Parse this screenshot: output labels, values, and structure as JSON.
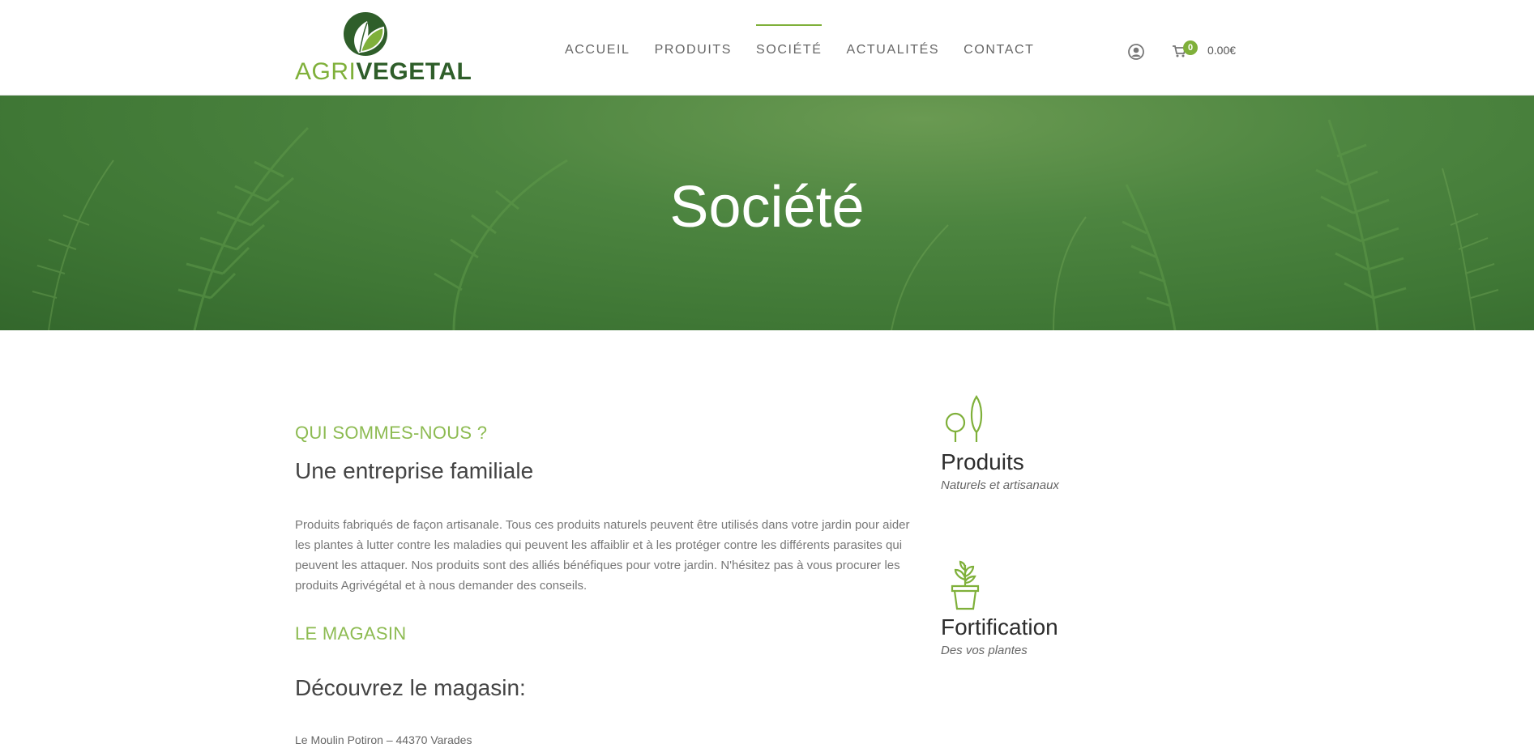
{
  "brand": {
    "part1": "AGRI",
    "part2": "VEGETAL",
    "primary_color": "#7fb03a",
    "dark_color": "#2f5e2a"
  },
  "nav": {
    "items": [
      {
        "label": "ACCUEIL"
      },
      {
        "label": "PRODUITS"
      },
      {
        "label": "SOCIÉTÉ",
        "active": true
      },
      {
        "label": "ACTUALITÉS"
      },
      {
        "label": "CONTACT"
      }
    ]
  },
  "account": {
    "icon": "user-icon"
  },
  "cart": {
    "icon": "cart-icon",
    "count": "0",
    "total": "0.00€"
  },
  "hero": {
    "title": "Société"
  },
  "about": {
    "kicker": "QUI SOMMES-NOUS ?",
    "heading": "Une entreprise familiale",
    "text": "Produits fabriqués de façon artisanale. Tous ces produits naturels peuvent être utilisés dans votre jardin pour aider les plantes à lutter contre les maladies qui peuvent les affaiblir et à les protéger contre les différents parasites qui peuvent les attaquer. Nos produits sont des alliés bénéfiques pour votre jardin. N'hésitez pas à vous procurer les produits Agrivégétal et à nous demander des conseils."
  },
  "store": {
    "kicker": "LE MAGASIN",
    "heading": "Découvrez le magasin:",
    "address": "Le Moulin Potiron – 44370 Varades"
  },
  "features": [
    {
      "icon": "trees-icon",
      "title": "Produits",
      "subtitle": "Naturels et artisanaux"
    },
    {
      "icon": "potted-plant-icon",
      "title": "Fortification",
      "subtitle": "Des vos plantes"
    }
  ]
}
